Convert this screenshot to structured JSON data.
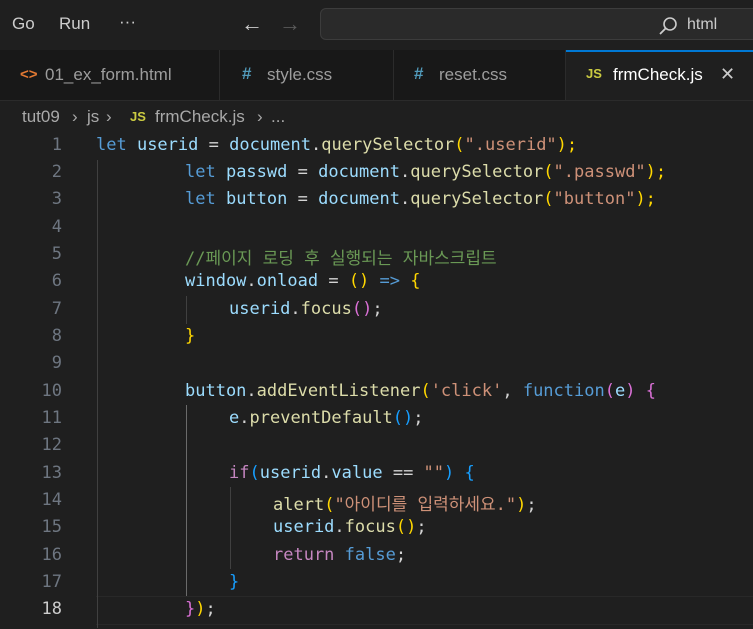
{
  "menu": {
    "go": "Go",
    "run": "Run",
    "more": "···"
  },
  "search": {
    "text": "html"
  },
  "tabs": [
    {
      "label": "01_ex_form.html",
      "icon": "<>",
      "icon_color": "#e37933"
    },
    {
      "label": "style.css",
      "icon": "#",
      "icon_color": "#519aba"
    },
    {
      "label": "reset.css",
      "icon": "#",
      "icon_color": "#519aba"
    },
    {
      "label": "frmCheck.js",
      "icon": "JS",
      "icon_color": "#cbcb41",
      "active": true,
      "close": "✕"
    }
  ],
  "breadcrumb": {
    "folder1": "tut09",
    "folder2": "js",
    "file_icon": "JS",
    "file": "frmCheck.js",
    "more": "..."
  },
  "line_numbers": [
    "1",
    "2",
    "3",
    "4",
    "5",
    "6",
    "7",
    "8",
    "9",
    "10",
    "11",
    "12",
    "13",
    "14",
    "15",
    "16",
    "17",
    "18"
  ],
  "code": {
    "l1": {
      "a": "let",
      "b": " userid ",
      "c": "=",
      "d": " document",
      "e": ".",
      "f": "querySelector",
      "g": "(",
      "h": "\".userid\"",
      "i": ");"
    },
    "l2": {
      "a": "let",
      "b": " passwd ",
      "c": "=",
      "d": " document",
      "e": ".",
      "f": "querySelector",
      "g": "(",
      "h": "\".passwd\"",
      "i": ");"
    },
    "l3": {
      "a": "let",
      "b": " button ",
      "c": "=",
      "d": " document",
      "e": ".",
      "f": "querySelector",
      "g": "(",
      "h": "\"button\"",
      "i": ");"
    },
    "l5": "//페이지 로딩 후 실행되는 자바스크립트",
    "l6": {
      "a": "window",
      "b": ".",
      "c": "onload",
      "d": " = ",
      "e": "()",
      "f": " => ",
      "g": "{"
    },
    "l7": {
      "a": "userid",
      "b": ".",
      "c": "focus",
      "d": "()",
      "e": ";"
    },
    "l8": "}",
    "l10": {
      "a": "button",
      "b": ".",
      "c": "addEventListener",
      "d": "(",
      "e": "'click'",
      "f": ", ",
      "g": "function",
      "h": "(",
      "i": "e",
      "j": ")",
      "k": " {"
    },
    "l11": {
      "a": "e",
      "b": ".",
      "c": "preventDefault",
      "d": "()",
      "e": ";"
    },
    "l13": {
      "a": "if",
      "b": "(",
      "c": "userid",
      "d": ".",
      "e": "value",
      "f": " == ",
      "g": "\"\"",
      "h": ")",
      "i": " {"
    },
    "l14": {
      "a": "alert",
      "b": "(",
      "c": "\"아이디를 입력하세요.\"",
      "d": ")",
      "e": ";"
    },
    "l15": {
      "a": "userid",
      "b": ".",
      "c": "focus",
      "d": "()",
      "e": ";"
    },
    "l16": {
      "a": "return",
      "b": " false",
      "c": ";"
    },
    "l17": "}",
    "l18": {
      "a": "}",
      "b": ")",
      "c": ";"
    }
  }
}
